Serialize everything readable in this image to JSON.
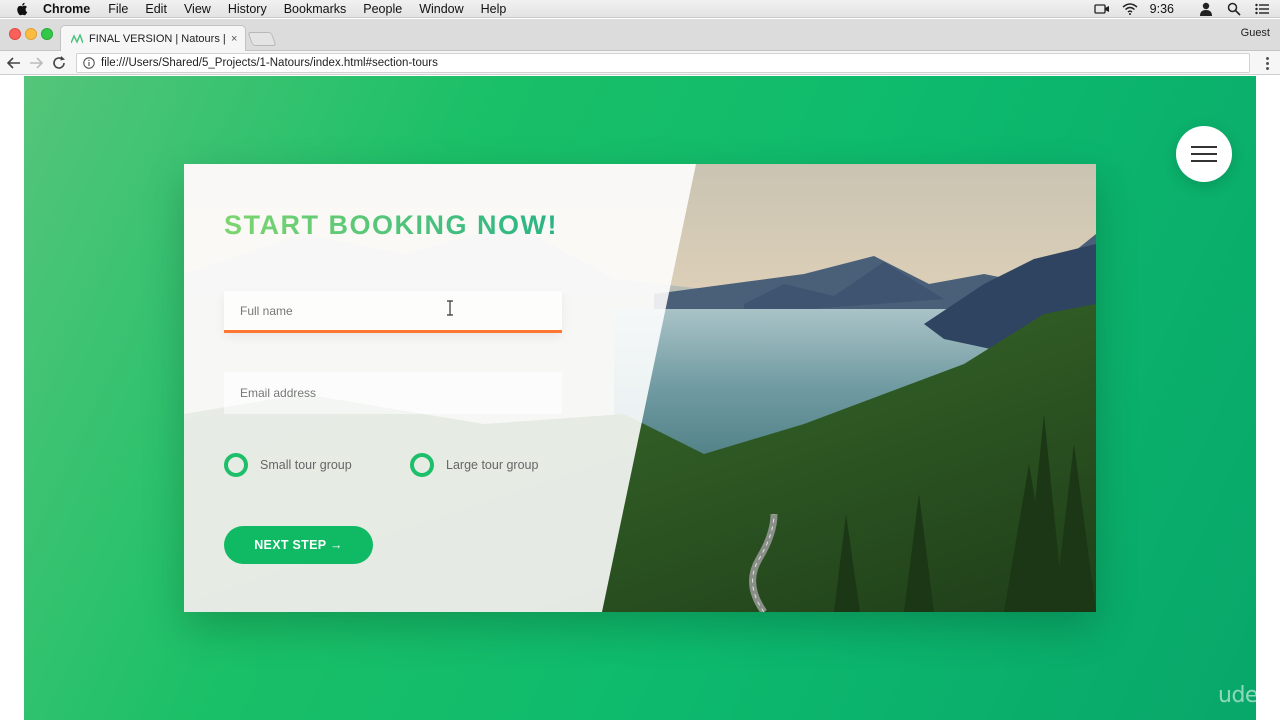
{
  "menubar": {
    "app_name": "Chrome",
    "items": [
      "File",
      "Edit",
      "View",
      "History",
      "Bookmarks",
      "People",
      "Window",
      "Help"
    ],
    "clock": "9:36"
  },
  "browser": {
    "tab_title": "FINAL VERSION | Natours | Ex",
    "tab_close": "×",
    "profile": "Guest",
    "url": "file:///Users/Shared/5_Projects/1-Natours/index.html#section-tours"
  },
  "booking": {
    "heading": "START BOOKING NOW!",
    "fullname_placeholder": "Full name",
    "email_placeholder": "Email address",
    "radio_small": "Small tour group",
    "radio_large": "Large tour group",
    "next_button": "NEXT STEP →"
  },
  "watermark": "udemy",
  "colors": {
    "green_primary": "#1dbf6a",
    "accent_orange": "#ff7730",
    "gradient_light": "#7ed56f",
    "gradient_dark": "#28b485"
  }
}
